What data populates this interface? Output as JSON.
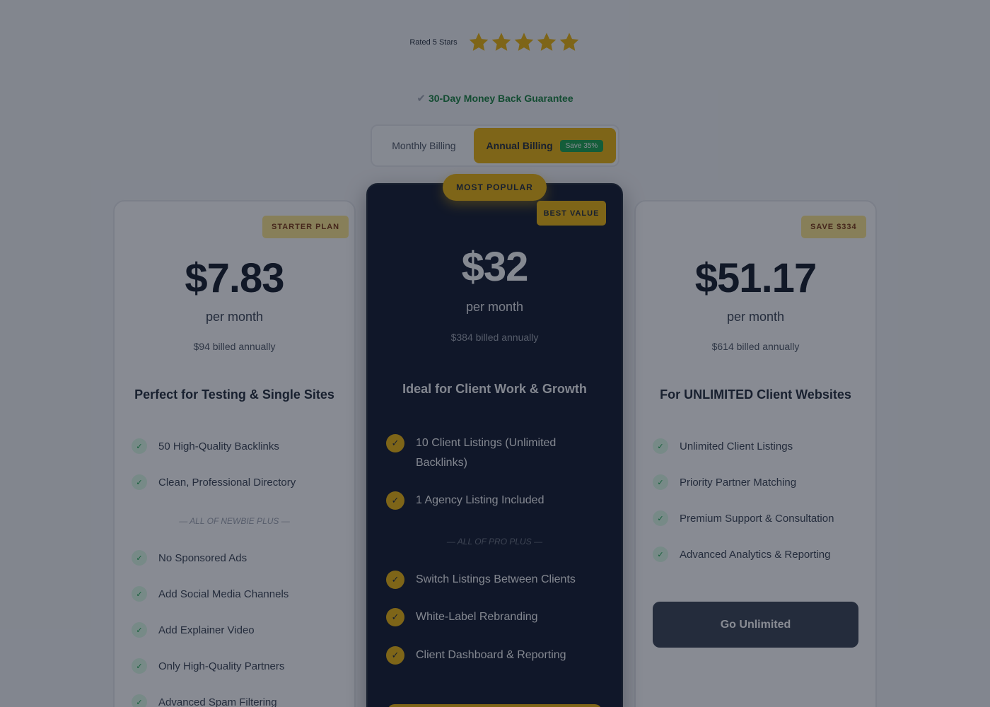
{
  "rating": {
    "text": "Rated 5 Stars",
    "stars": 5,
    "star_color": "#eab308"
  },
  "guarantee": {
    "check": "✔",
    "text": "30-Day Money Back Guarantee"
  },
  "billing_toggle": {
    "monthly_label": "Monthly Billing",
    "annual_label": "Annual Billing",
    "annual_save": "Save 35%",
    "selected": "annual"
  },
  "colors": {
    "accent": "#eab308",
    "dark_card": "#0f172a",
    "success": "#16a34a"
  },
  "plans": {
    "starter": {
      "badge": "STARTER PLAN",
      "price": "$7.83",
      "period": "per month",
      "billed": "$94 billed annually",
      "tagline": "Perfect for Testing & Single Sites",
      "features_a": [
        "50 High-Quality Backlinks",
        "Clean, Professional Directory"
      ],
      "divider": "— ALL OF NEWBIE PLUS —",
      "features_b": [
        "No Sponsored Ads",
        "Add Social Media Channels",
        "Add Explainer Video",
        "Only High-Quality Partners",
        "Advanced Spam Filtering"
      ]
    },
    "pro": {
      "ribbon": "MOST POPULAR",
      "badge": "BEST VALUE",
      "price": "$32",
      "period": "per month",
      "billed": "$384 billed annually",
      "tagline": "Ideal for Client Work & Growth",
      "features_a": [
        "10 Client Listings (Unlimited Backlinks)",
        "1 Agency Listing Included"
      ],
      "divider": "— ALL OF PRO PLUS —",
      "features_b": [
        "Switch Listings Between Clients",
        "White-Label Rebranding",
        "Client Dashboard & Reporting"
      ]
    },
    "unlimited": {
      "badge": "SAVE $334",
      "price": "$51.17",
      "period": "per month",
      "billed": "$614 billed annually",
      "tagline": "For UNLIMITED Client Websites",
      "features": [
        "Unlimited Client Listings",
        "Priority Partner Matching",
        "Premium Support & Consultation",
        "Advanced Analytics & Reporting"
      ],
      "cta": "Go Unlimited"
    }
  },
  "check_glyph": "✓"
}
